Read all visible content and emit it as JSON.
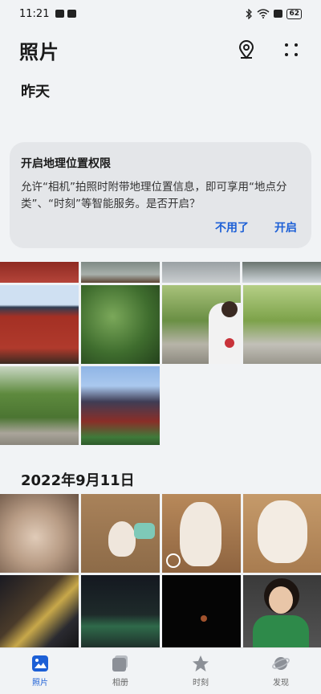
{
  "status_bar": {
    "time": "11:21",
    "battery": "62"
  },
  "header": {
    "title": "照片",
    "location_icon": "map-pin-icon",
    "more_icon": "more-dots-icon"
  },
  "sections": [
    {
      "date": "昨天"
    },
    {
      "date": "2022年9月11日"
    }
  ],
  "permission_card": {
    "title": "开启地理位置权限",
    "message": "允许“相机”拍照时附带地理位置信息，即可享用“地点分类”、“时刻”等智能服务。是否开启？",
    "decline_label": "不用了",
    "accept_label": "开启"
  },
  "tabs": [
    {
      "label": "照片",
      "icon": "photo-icon",
      "active": true
    },
    {
      "label": "相册",
      "icon": "album-icon",
      "active": false
    },
    {
      "label": "时刻",
      "icon": "star-icon",
      "active": false
    },
    {
      "label": "发现",
      "icon": "planet-icon",
      "active": false
    }
  ],
  "colors": {
    "accent": "#1c5fd6",
    "background": "#f1f3f5",
    "card": "#e4e6e9"
  }
}
